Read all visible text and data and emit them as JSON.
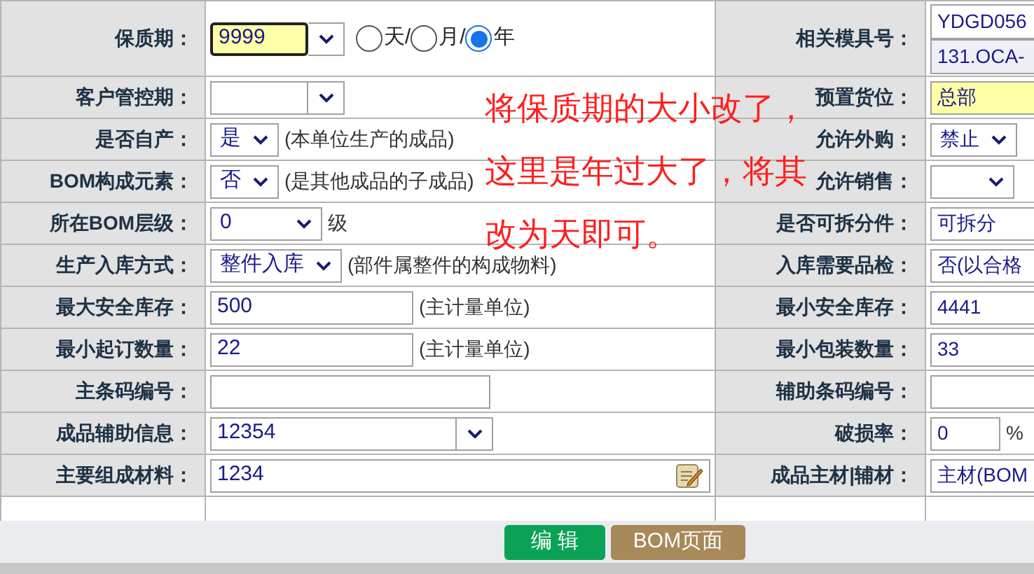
{
  "rows": [
    {
      "left": {
        "label": "保质期：",
        "field": {
          "kind": "combo",
          "value": "9999",
          "highlighted": true,
          "focused": true,
          "separator": "/",
          "units": [
            {
              "label": "天",
              "selected": false
            },
            {
              "label": "月",
              "selected": false
            },
            {
              "label": "年",
              "selected": true
            }
          ]
        }
      },
      "right": {
        "label": "相关模具号：",
        "field": {
          "kind": "stack",
          "lines": [
            "YDGD056",
            "131.OCA-"
          ]
        }
      }
    },
    {
      "left": {
        "label": "客户管控期：",
        "field": {
          "kind": "combo"
        }
      },
      "right": {
        "label": "预置货位：",
        "field": {
          "kind": "input",
          "value": "总部",
          "highlighted": true
        }
      }
    },
    {
      "left": {
        "label": "是否自产：",
        "field": {
          "kind": "select",
          "value": "是",
          "note": "(本单位生产的成品)"
        }
      },
      "right": {
        "label": "允许外购：",
        "field": {
          "kind": "select",
          "value": "禁止"
        }
      }
    },
    {
      "left": {
        "label": "BOM构成元素：",
        "field": {
          "kind": "select",
          "value": "否",
          "note": "(是其他成品的子成品)"
        }
      },
      "right": {
        "label": "允许销售：",
        "field": {
          "kind": "select"
        }
      }
    },
    {
      "left": {
        "label": "所在BOM层级：",
        "field": {
          "kind": "select",
          "value": "0",
          "note": "级"
        }
      },
      "right": {
        "label": "是否可拆分件：",
        "field": {
          "kind": "input",
          "value": "可拆分"
        }
      }
    },
    {
      "left": {
        "label": "生产入库方式：",
        "field": {
          "kind": "select",
          "value": "整件入库",
          "note": "(部件属整件的构成物料)"
        }
      },
      "right": {
        "label": "入库需要品检：",
        "field": {
          "kind": "input",
          "value": "否(以合格"
        }
      }
    },
    {
      "left": {
        "label": "最大安全库存：",
        "field": {
          "kind": "input",
          "value": "500",
          "note": "(主计量单位)"
        }
      },
      "right": {
        "label": "最小安全库存：",
        "field": {
          "kind": "input",
          "value": "4441"
        }
      }
    },
    {
      "left": {
        "label": "最小起订数量：",
        "field": {
          "kind": "input",
          "value": "22",
          "note": "(主计量单位)"
        }
      },
      "right": {
        "label": "最小包装数量：",
        "field": {
          "kind": "input",
          "value": "33"
        }
      }
    },
    {
      "left": {
        "label": "主条码编号：",
        "field": {
          "kind": "input"
        }
      },
      "right": {
        "label": "辅助条码编号：",
        "field": {
          "kind": "input"
        }
      }
    },
    {
      "left": {
        "label": "成品辅助信息：",
        "field": {
          "kind": "combo",
          "value": "12354"
        }
      },
      "right": {
        "label": "破损率：",
        "field": {
          "kind": "input",
          "value": "0",
          "note": "%"
        }
      }
    },
    {
      "left": {
        "label": "主要组成材料：",
        "field": {
          "kind": "input",
          "value": "1234",
          "editor": true
        }
      },
      "right": {
        "label": "成品主材|辅材：",
        "field": {
          "kind": "input",
          "value": "主材(BOM"
        }
      }
    }
  ],
  "annotation": {
    "lines": [
      "将保质期的大小改了，",
      "这里是年过大了，将其",
      "改为天即可。"
    ]
  },
  "footer": {
    "buttons": [
      {
        "label": "编 辑",
        "kind": "primary"
      },
      {
        "label": "BOM页面",
        "kind": "secondary"
      }
    ]
  }
}
